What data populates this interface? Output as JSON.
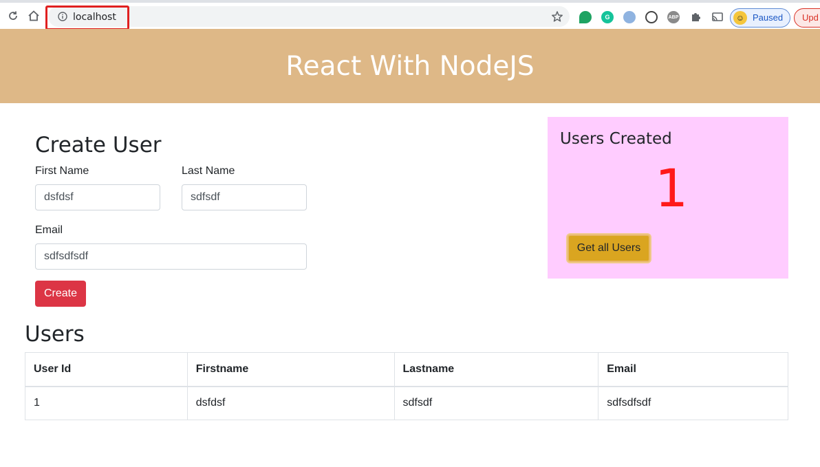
{
  "browser": {
    "url": "localhost",
    "profile_status": "Paused",
    "update_label": "Upd"
  },
  "app": {
    "title": "React With NodeJS"
  },
  "create_form": {
    "title": "Create User",
    "first_name_label": "First Name",
    "first_name_value": "dsfdsf",
    "last_name_label": "Last Name",
    "last_name_value": "sdfsdf",
    "email_label": "Email",
    "email_value": "sdfsdfsdf",
    "create_label": "Create"
  },
  "stats": {
    "title": "Users Created",
    "count": "1",
    "get_users_label": "Get all Users"
  },
  "users_table": {
    "title": "Users",
    "headers": [
      "User Id",
      "Firstname",
      "Lastname",
      "Email"
    ],
    "rows": [
      [
        "1",
        "dsfdsf",
        "sdfsdf",
        "sdfsdfsdf"
      ]
    ]
  },
  "colors": {
    "header_bg": "#deb887",
    "create_btn": "#dc3545",
    "stats_bg": "#ffccff",
    "count_color": "#ff1a1a",
    "get_users_btn": "#daa520"
  }
}
